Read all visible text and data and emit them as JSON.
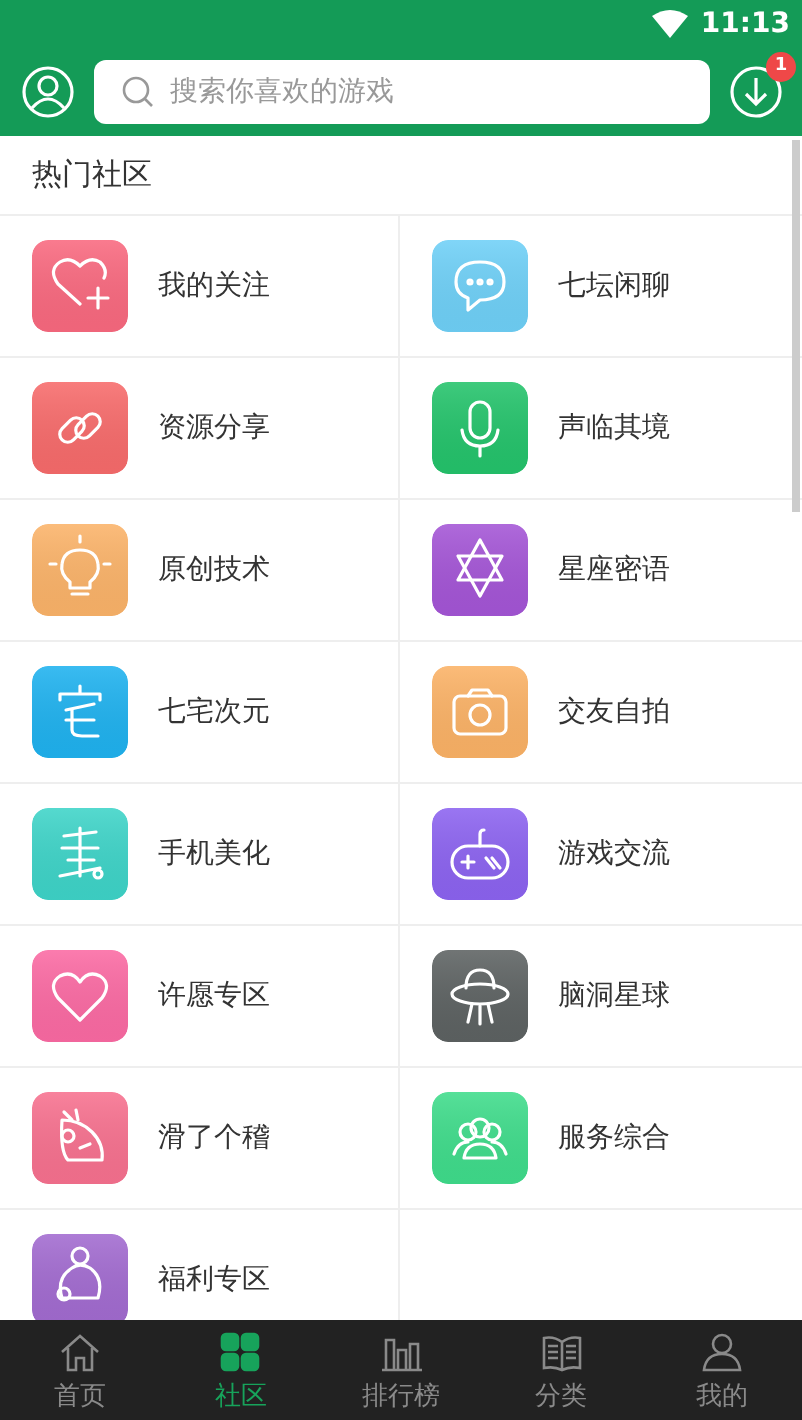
{
  "status_bar": {
    "time": "11:13"
  },
  "toolbar": {
    "search": {
      "placeholder": "搜索你喜欢的游戏"
    },
    "download_badge": "1"
  },
  "section": {
    "title": "热门社区"
  },
  "forums": [
    {
      "label": "我的关注",
      "color": "#f9697f"
    },
    {
      "label": "七坛闲聊",
      "color": "#6fd0f7"
    },
    {
      "label": "资源分享",
      "color": "#f76b6b"
    },
    {
      "label": "声临其境",
      "color": "#24c36b"
    },
    {
      "label": "原创技术",
      "color": "#fbb369"
    },
    {
      "label": "星座密语",
      "color": "#a455d6"
    },
    {
      "label": "七宅次元",
      "color": "#1fb2ef"
    },
    {
      "label": "交友自拍",
      "color": "#fbb266"
    },
    {
      "label": "手机美化",
      "color": "#3ed4c8"
    },
    {
      "label": "游戏交流",
      "color": "#8c63f0"
    },
    {
      "label": "许愿专区",
      "color": "#fb6aa3"
    },
    {
      "label": "脑洞星球",
      "color": "#5d6262"
    },
    {
      "label": "滑了个稽",
      "color": "#f7718f"
    },
    {
      "label": "服务综合",
      "color": "#3fdc8b"
    },
    {
      "label": "福利专区",
      "color": "#a26bd0"
    }
  ],
  "bottom_nav": [
    {
      "label": "首页",
      "selected": false
    },
    {
      "label": "社区",
      "selected": true
    },
    {
      "label": "排行榜",
      "selected": false
    },
    {
      "label": "分类",
      "selected": false
    },
    {
      "label": "我的",
      "selected": false
    }
  ]
}
